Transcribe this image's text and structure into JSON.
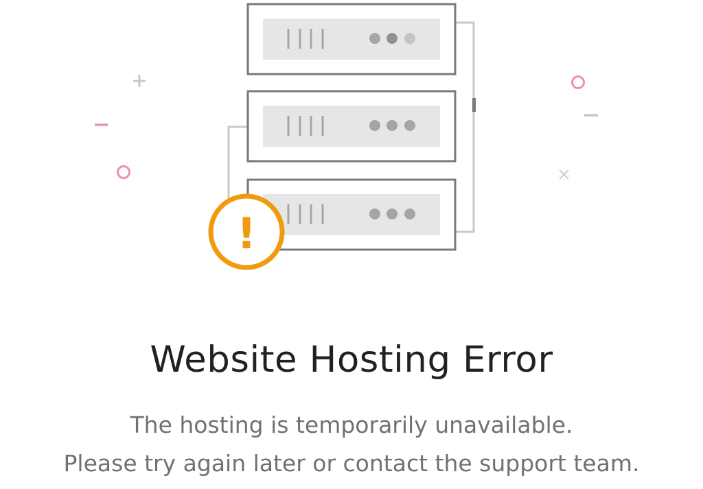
{
  "error_page": {
    "title": "Website Hosting Error",
    "message_line1": "The hosting is temporarily unavailable.",
    "message_line2": "Please try again later or contact the support team."
  },
  "illustration": {
    "icons": [
      "server-rack-icon",
      "warning-exclamation-icon",
      "plus-icon",
      "minus-icon",
      "circle-icon",
      "cross-icon"
    ],
    "warning_symbol": "!",
    "colors": {
      "server_stroke": "#77797c",
      "server_panel": "#e6e6e6",
      "indicator": "#a3a5a7",
      "warning": "#f29a0e",
      "accent_pink": "#f08fb1",
      "decor_gray": "#c7c8ca"
    }
  }
}
